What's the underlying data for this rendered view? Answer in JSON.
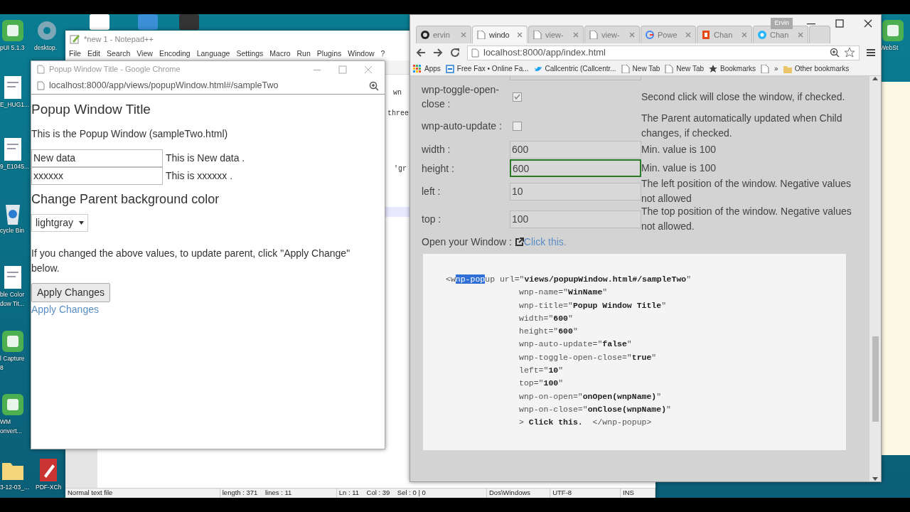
{
  "desktop": {
    "icons": [
      {
        "label": [
          "pUI 5.1.3"
        ],
        "kind": "app"
      },
      {
        "label": [
          "desktop."
        ],
        "kind": "gear"
      },
      {
        "label": [
          "E_HUG1..."
        ],
        "kind": "doc"
      },
      {
        "label": [
          "9_E1045..."
        ],
        "kind": "doc"
      },
      {
        "label": [
          "cycle Bin"
        ],
        "kind": "bin"
      },
      {
        "label": [
          "ble Color",
          "dow Tit..."
        ],
        "kind": "doc"
      },
      {
        "label": [
          "l Capture",
          "8"
        ],
        "kind": "app"
      },
      {
        "label": [
          "WM",
          "onvert..."
        ],
        "kind": "app"
      },
      {
        "label": [
          "3-12-03_..."
        ],
        "kind": "folder"
      },
      {
        "label": [
          "PDF-XCh"
        ],
        "kind": "pdf"
      },
      {
        "label": [
          "WebSt"
        ],
        "kind": "app"
      }
    ]
  },
  "notepad": {
    "title": "*new 1 - Notepad++",
    "menu": [
      "File",
      "Edit",
      "Search",
      "View",
      "Encoding",
      "Language",
      "Settings",
      "Macro",
      "Run",
      "Plugins",
      "Window",
      "?"
    ],
    "code_fragments": [
      "wn",
      "three",
      "'gr"
    ],
    "status_bar": [
      "Normal text file",
      "length : 371    lines : 11",
      "Ln : 11    Col : 39    Sel : 0 | 0",
      "Dos\\Windows",
      "UTF-8",
      "INS"
    ]
  },
  "popup_window": {
    "title": "Popup Window Title - Google Chrome",
    "address": "localhost:8000/app/views/popupWindow.html#/sampleTwo",
    "heading": "Popup Window Title",
    "intro": "This is the Popup Window (sampleTwo.html)",
    "fields": [
      {
        "value": "New data",
        "echo": "This is New data ."
      },
      {
        "value": "xxxxxx",
        "echo": "This is xxxxxx ."
      }
    ],
    "subheading": "Change Parent background color",
    "select": "lightgray",
    "note": "If you changed the above values, to update parent, click \"Apply Change\" below.",
    "button": "Apply Changes",
    "link": "Apply Changes"
  },
  "browser": {
    "profile": "Ervin",
    "tabs": [
      {
        "label": "ervin",
        "kind": "github",
        "selected": false
      },
      {
        "label": "windo",
        "kind": "page",
        "selected": true
      },
      {
        "label": "view-",
        "kind": "page",
        "selected": false
      },
      {
        "label": "view-",
        "kind": "page",
        "selected": false
      },
      {
        "label": "Powe",
        "kind": "google",
        "selected": false
      },
      {
        "label": "Chan",
        "kind": "office",
        "selected": false
      },
      {
        "label": "Chan",
        "kind": "circle",
        "selected": false
      }
    ],
    "address": "localhost:8000/app/index.html",
    "bookmarks": [
      {
        "label": "Apps",
        "kind": "apps"
      },
      {
        "label": "Free Fax • Online Fa...",
        "kind": "fax"
      },
      {
        "label": "Callcentric (Callcentr...",
        "kind": "bird"
      },
      {
        "label": "New Tab",
        "kind": "page"
      },
      {
        "label": "New Tab",
        "kind": "page"
      },
      {
        "label": "Bookmarks",
        "kind": "star"
      },
      {
        "kind": "page"
      },
      {
        "label": "»",
        "kind": "more"
      },
      {
        "label": "Other bookmarks",
        "kind": "folder"
      }
    ],
    "form": [
      {
        "kind": "checkbox",
        "label": "wnp-toggle-open-close :",
        "checked": true,
        "hint": "Second click will close the window, if checked."
      },
      {
        "kind": "checkbox",
        "label": "wnp-auto-update :",
        "checked": false,
        "hint": "The Parent automatically updated when Child changes, if checked."
      },
      {
        "kind": "input",
        "label": "width :",
        "value": "600",
        "focused": false,
        "hint": "Min. value is 100"
      },
      {
        "kind": "input",
        "label": "height :",
        "value": "600",
        "focused": true,
        "hint": "Min. value is 100"
      },
      {
        "kind": "input",
        "label": "left :",
        "value": "10",
        "focused": false,
        "hint": "The left position of the window. Negative values not allowed"
      },
      {
        "kind": "input",
        "label": "top :",
        "value": "100",
        "focused": false,
        "hint": "The top position of the window. Negative values not allowed."
      }
    ],
    "open_label": "Open your Window :",
    "open_link": "Click this.",
    "code": {
      "opening": [
        {
          "text": "<w",
          "selected": false
        },
        {
          "text": "np-pop",
          "selected": true
        },
        {
          "text": "up url=\"**views/popupWindow.html#/sampleTwo**\"",
          "selected": false
        }
      ],
      "lines": [
        "wnp-name=\"**WinName**\"",
        "wnp-title=\"**Popup Window Title**\"",
        "width=\"**600**\"",
        "height=\"**600**\"",
        "wnp-auto-update=\"**false**\"",
        "wnp-toggle-open-close=\"**true**\"",
        "left=\"**10**\"",
        "top=\"**100**\"",
        "wnp-on-open=\"**onOpen(wnpName)**\"",
        "wnp-on-close=\"**onClose(wnpName)**\"",
        "> **Click this.**  </wnp-popup>"
      ]
    }
  }
}
